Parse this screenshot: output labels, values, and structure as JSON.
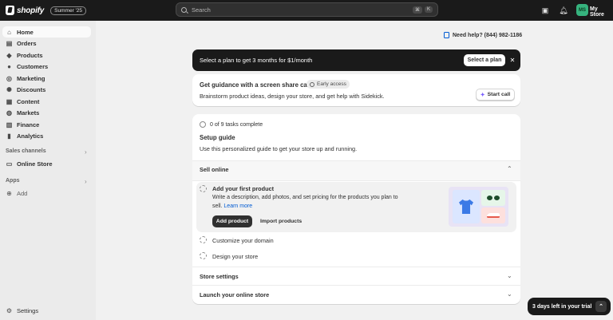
{
  "topbar": {
    "brand": "shopify",
    "edition": "Summer '25",
    "search_placeholder": "Search",
    "shortcut_keys": [
      "⌘",
      "K"
    ],
    "avatar_initials": "MS",
    "store_name": "My Store",
    "icons": [
      "store-icon",
      "bell-icon"
    ]
  },
  "sidebar": {
    "items": [
      {
        "label": "Home",
        "icon": "home-icon",
        "active": true
      },
      {
        "label": "Orders",
        "icon": "orders-icon"
      },
      {
        "label": "Products",
        "icon": "tag-icon"
      },
      {
        "label": "Customers",
        "icon": "person-icon"
      },
      {
        "label": "Marketing",
        "icon": "target-icon"
      },
      {
        "label": "Discounts",
        "icon": "discount-icon"
      },
      {
        "label": "Content",
        "icon": "content-icon"
      },
      {
        "label": "Markets",
        "icon": "globe-icon"
      },
      {
        "label": "Finance",
        "icon": "bank-icon"
      },
      {
        "label": "Analytics",
        "icon": "chart-icon"
      }
    ],
    "sales_channels_label": "Sales channels",
    "online_store_label": "Online Store",
    "apps_label": "Apps",
    "add_label": "Add",
    "settings_label": "Settings"
  },
  "help": {
    "text": "Need help? (844) 982-1186"
  },
  "banner": {
    "text": "Select a plan to get 3 months for $1/month",
    "button": "Select a plan",
    "close": "✕"
  },
  "guidance": {
    "title": "Get guidance with a screen share call",
    "badge": "Early access",
    "description": "Brainstorm product ideas, design your store, and get help with Sidekick.",
    "button": "Start call"
  },
  "setup": {
    "progress": "0 of 9 tasks complete",
    "title": "Setup guide",
    "description": "Use this personalized guide to get your store up and running.",
    "sell_online": "Sell online",
    "task_add_product_title": "Add your first product",
    "task_add_product_desc": "Write a description, add photos, and set pricing for the products you plan to sell.",
    "learn_more": "Learn more",
    "add_product_button": "Add product",
    "import_products_button": "Import products",
    "task_customize_domain": "Customize your domain",
    "task_design_store": "Design your store",
    "store_settings": "Store settings",
    "launch_store": "Launch your online store"
  },
  "trial": {
    "text": "3 days left in your trial"
  }
}
